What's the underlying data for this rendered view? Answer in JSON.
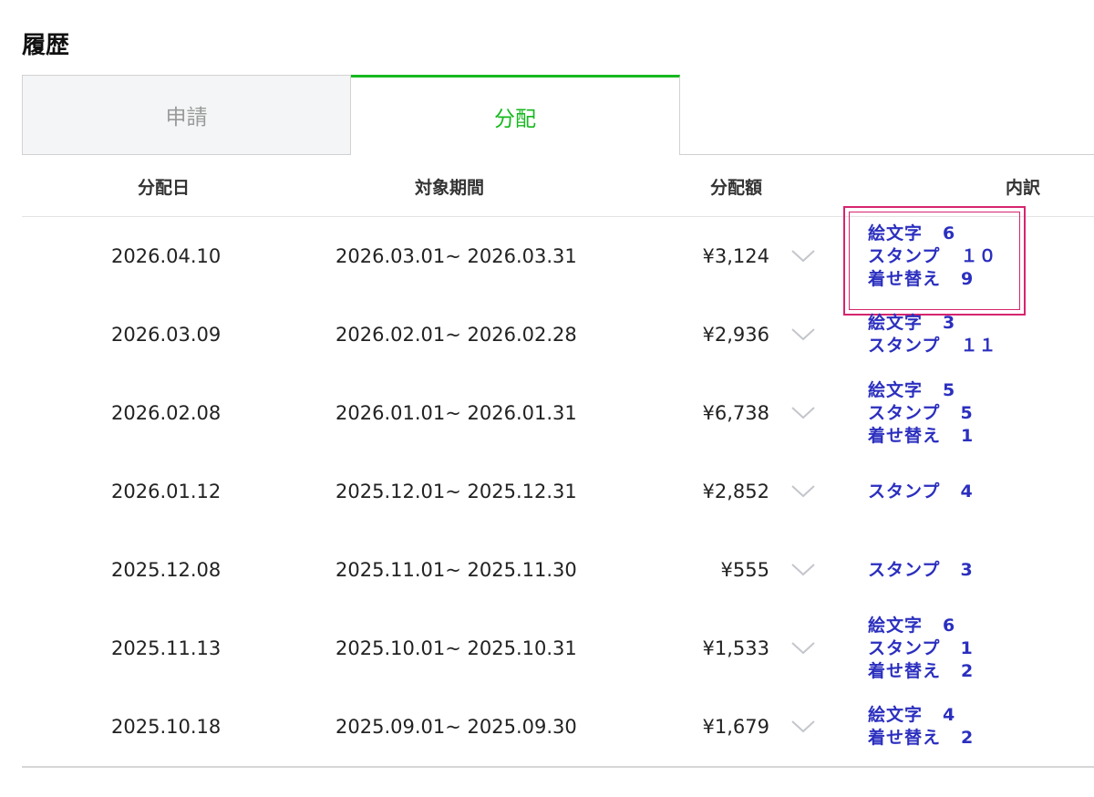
{
  "page_title": "履歴",
  "tabs": [
    {
      "label": "申請",
      "active": false
    },
    {
      "label": "分配",
      "active": true
    }
  ],
  "columns": {
    "date": "分配日",
    "period": "対象期間",
    "amount": "分配額",
    "detail": "内訳"
  },
  "colors": {
    "accent_green": "#17b81f",
    "detail_blue": "#2b2fbf",
    "highlight_pink": "#d6246e"
  },
  "rows": [
    {
      "date": "2026.04.10",
      "period": "2026.03.01~ 2026.03.31",
      "amount": "¥3,124",
      "highlighted": true,
      "details": [
        {
          "label": "絵文字",
          "count": "6"
        },
        {
          "label": "スタンプ",
          "count": "１０"
        },
        {
          "label": "着せ替え",
          "count": "9"
        }
      ]
    },
    {
      "date": "2026.03.09",
      "period": "2026.02.01~ 2026.02.28",
      "amount": "¥2,936",
      "details": [
        {
          "label": "絵文字",
          "count": "3"
        },
        {
          "label": "スタンプ",
          "count": "１１"
        }
      ]
    },
    {
      "date": "2026.02.08",
      "period": "2026.01.01~ 2026.01.31",
      "amount": "¥6,738",
      "details": [
        {
          "label": "絵文字",
          "count": "5"
        },
        {
          "label": "スタンプ",
          "count": "5"
        },
        {
          "label": "着せ替え",
          "count": "1"
        }
      ]
    },
    {
      "date": "2026.01.12",
      "period": "2025.12.01~ 2025.12.31",
      "amount": "¥2,852",
      "details": [
        {
          "label": "スタンプ",
          "count": "4"
        }
      ]
    },
    {
      "date": "2025.12.08",
      "period": "2025.11.01~ 2025.11.30",
      "amount": "¥555",
      "details": [
        {
          "label": "スタンプ",
          "count": "3"
        }
      ]
    },
    {
      "date": "2025.11.13",
      "period": "2025.10.01~ 2025.10.31",
      "amount": "¥1,533",
      "details": [
        {
          "label": "絵文字",
          "count": "6"
        },
        {
          "label": "スタンプ",
          "count": "1"
        },
        {
          "label": "着せ替え",
          "count": "2"
        }
      ]
    },
    {
      "date": "2025.10.18",
      "period": "2025.09.01~ 2025.09.30",
      "amount": "¥1,679",
      "details": [
        {
          "label": "絵文字",
          "count": "4"
        },
        {
          "label": "着せ替え",
          "count": "2"
        }
      ]
    }
  ]
}
